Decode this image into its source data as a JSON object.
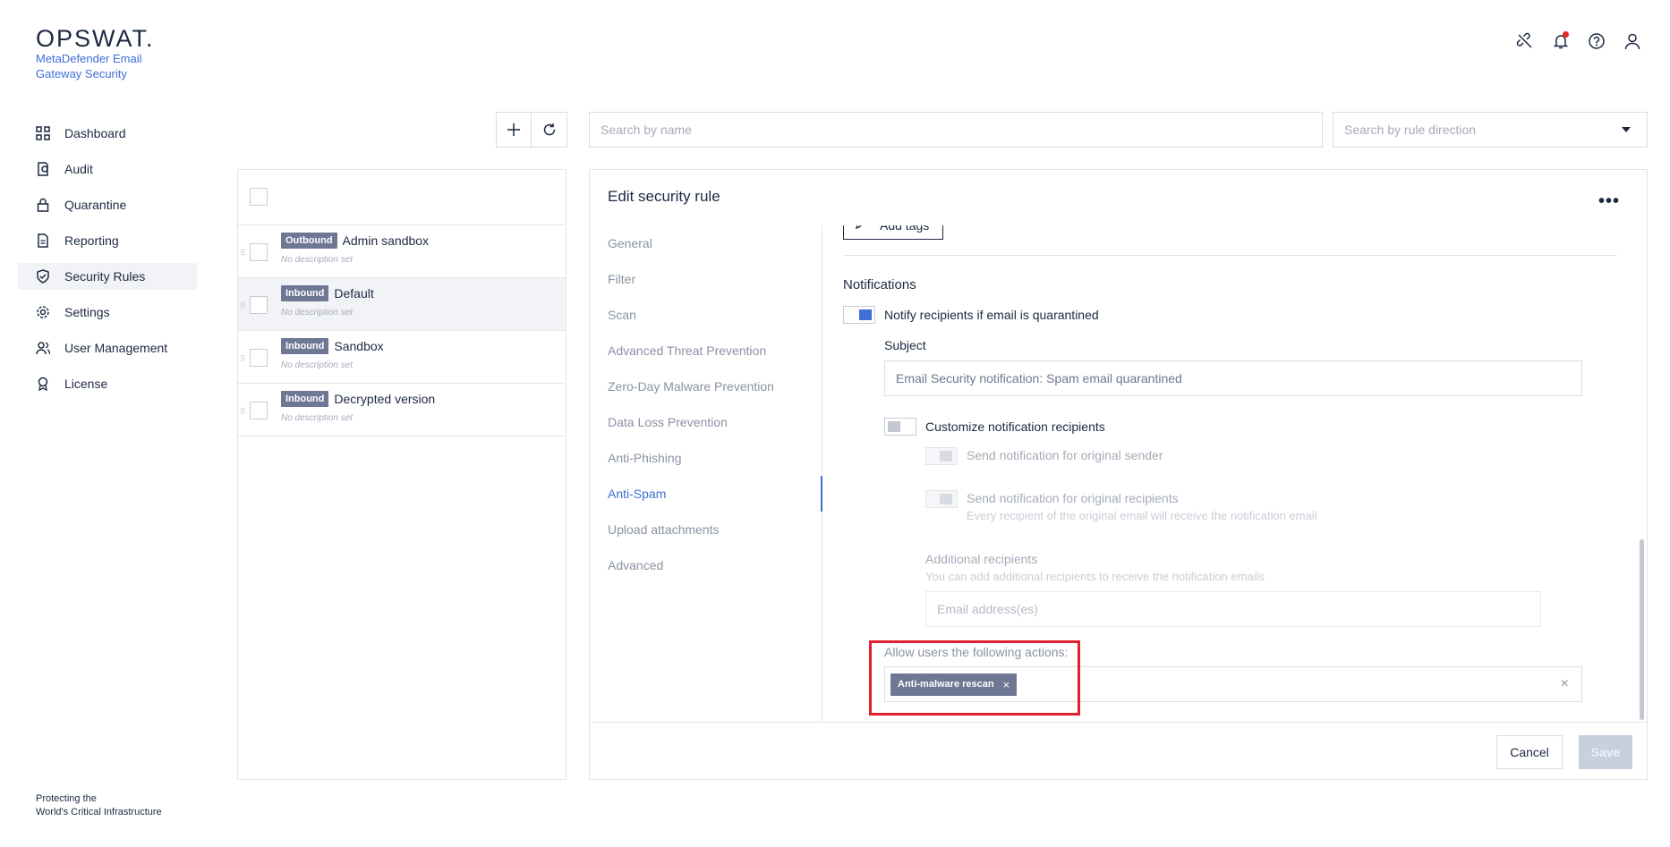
{
  "brand": {
    "logo": "OPSWAT.",
    "product": "MetaDefender Email Gateway Security",
    "tagline_line1": "Protecting the",
    "tagline_line2": "World's Critical Infrastructure"
  },
  "sidebar": {
    "items": [
      {
        "label": "Dashboard",
        "icon": "dashboard-icon"
      },
      {
        "label": "Audit",
        "icon": "audit-icon"
      },
      {
        "label": "Quarantine",
        "icon": "lock-icon"
      },
      {
        "label": "Reporting",
        "icon": "document-icon"
      },
      {
        "label": "Security Rules",
        "icon": "shield-check-icon",
        "active": true
      },
      {
        "label": "Settings",
        "icon": "gear-icon"
      },
      {
        "label": "User Management",
        "icon": "users-icon"
      },
      {
        "label": "License",
        "icon": "award-icon"
      }
    ]
  },
  "search": {
    "name_placeholder": "Search by name",
    "direction_placeholder": "Search by rule direction"
  },
  "rules": [
    {
      "direction": "Outbound",
      "name": "Admin sandbox",
      "description": "No description set"
    },
    {
      "direction": "Inbound",
      "name": "Default",
      "description": "No description set",
      "selected": true
    },
    {
      "direction": "Inbound",
      "name": "Sandbox",
      "description": "No description set"
    },
    {
      "direction": "Inbound",
      "name": "Decrypted version",
      "description": "No description set"
    }
  ],
  "edit": {
    "title": "Edit security rule",
    "more": "•••",
    "tabs": [
      "General",
      "Filter",
      "Scan",
      "Advanced Threat Prevention",
      "Zero-Day Malware Prevention",
      "Data Loss Prevention",
      "Anti-Phishing",
      "Anti-Spam",
      "Upload attachments",
      "Advanced"
    ],
    "active_tab": "Anti-Spam",
    "add_tags": "Add tags",
    "notifications_title": "Notifications",
    "notify_label": "Notify recipients if email is quarantined",
    "subject_label": "Subject",
    "subject_value": "Email Security notification: Spam email quarantined",
    "customize_label": "Customize notification recipients",
    "original_sender_label": "Send notification for original sender",
    "original_recipients_label": "Send notification for original recipients",
    "original_recipients_hint": "Every recipient of the original email will receive the notification email",
    "additional_label": "Additional recipients",
    "additional_hint": "You can add additional recipients to receive the notification emails",
    "email_placeholder": "Email address(es)",
    "allow_label": "Allow users the following actions:",
    "allowed_actions": [
      "Anti-malware rescan"
    ],
    "cancel": "Cancel",
    "save": "Save"
  },
  "colors": {
    "accent": "#3f6ed6",
    "badge": "#6e7794",
    "highlight": "#e0212e"
  }
}
